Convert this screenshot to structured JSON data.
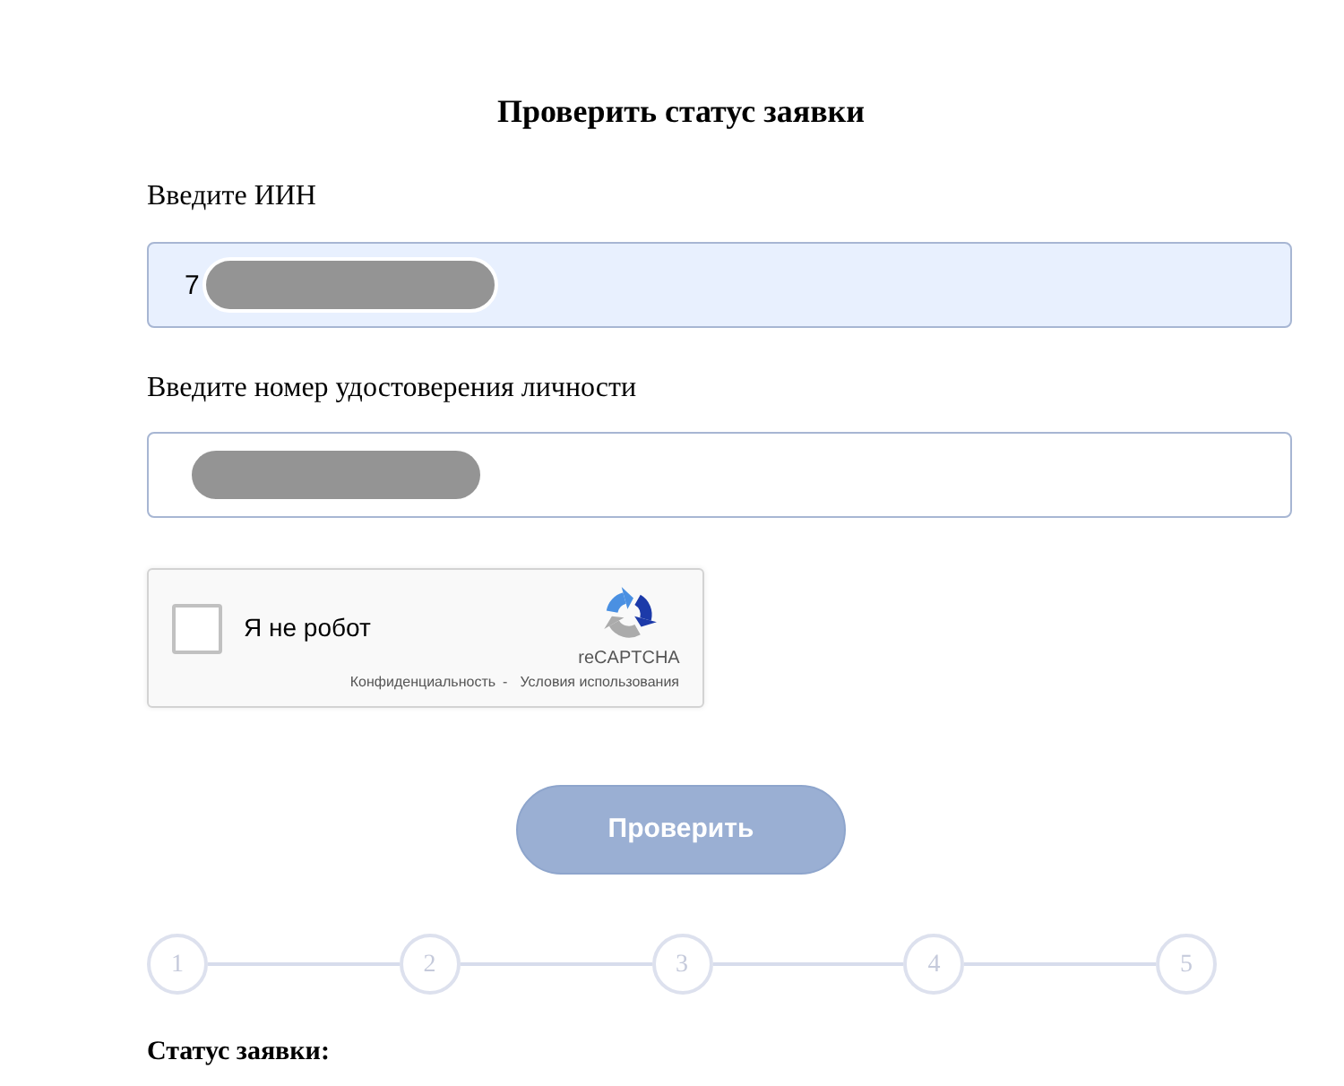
{
  "title": "Проверить статус заявки",
  "fields": [
    {
      "label": "Введите ИИН",
      "value": "7",
      "autofilled": true,
      "redacted": true
    },
    {
      "label": "Введите номер удостоверения личности",
      "autofilled": false,
      "redacted": true
    }
  ],
  "captcha": {
    "checked": false,
    "label": "Я не робот",
    "brand": "reCAPTCHA",
    "links": [
      "Конфиденциальность",
      "Условия использования"
    ],
    "separator": "-"
  },
  "submit": {
    "label": "Проверить",
    "disabled": true
  },
  "steps": [
    {
      "number": "1",
      "active": false
    },
    {
      "number": "2",
      "active": false
    },
    {
      "number": "3",
      "active": false
    },
    {
      "number": "4",
      "active": false
    },
    {
      "number": "5",
      "active": false
    }
  ],
  "status_label": "Статус заявки:"
}
